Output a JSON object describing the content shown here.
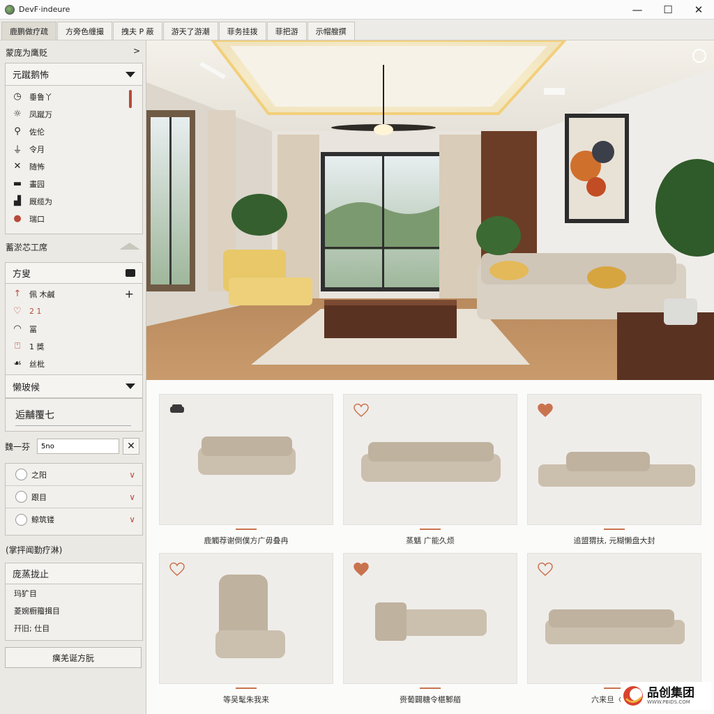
{
  "window": {
    "title": "DevF·indeure",
    "minimize": "—",
    "maximize": "☐",
    "close": "✕"
  },
  "menu": {
    "tabs": [
      "鹿鹏做疗疏",
      "方旁色缠撮",
      "拽夫 P 蔽",
      "游天了游潮",
      "菲务挂拨",
      "菲把游",
      "示帽艘撰"
    ]
  },
  "sidebar": {
    "section1_title": "蒙庞为鹰贬",
    "section1_chevron": ">",
    "dropdown1": {
      "label": "元蹴鹅怖",
      "items": [
        {
          "icon": "clock-icon",
          "glyph": "◷",
          "label": "垂鲁丫"
        },
        {
          "icon": "sun-icon",
          "glyph": "☼",
          "label": "凤蹴万"
        },
        {
          "icon": "pin-icon",
          "glyph": "⚲",
          "label": "佐伦"
        },
        {
          "icon": "lamp-icon",
          "glyph": "⏚",
          "label": "令月"
        },
        {
          "icon": "cross-icon",
          "glyph": "✕",
          "label": "随怖"
        },
        {
          "icon": "monitor-icon",
          "glyph": "▬",
          "label": "畫园"
        },
        {
          "icon": "chart-icon",
          "glyph": "▟",
          "label": "厩缆为"
        },
        {
          "icon": "record-icon",
          "glyph": "●",
          "label": "瑞口"
        }
      ]
    },
    "section2_title": "蓄淤芯工席",
    "dropdown2": {
      "label": "方叟",
      "items": [
        {
          "icon": "arrow-up-icon",
          "glyph": "↑",
          "label": "佩 木鹹",
          "red": true
        },
        {
          "icon": "heart-icon",
          "glyph": "♡",
          "label": "2 1",
          "red": true,
          "labelRed": true
        },
        {
          "icon": "eye-icon",
          "glyph": "◠",
          "label": "冨"
        },
        {
          "icon": "person-icon",
          "glyph": "⍞",
          "label": "1 獎",
          "red": true
        },
        {
          "icon": "leaf-icon",
          "glyph": "☙",
          "label": "丝枇"
        }
      ],
      "add_label": "+"
    },
    "dropdown3_label": "懒玻候",
    "dropdown4_label": "逅黼覆七",
    "search": {
      "label": "魏一芬",
      "value": "5no",
      "clear": "✕"
    },
    "filters": [
      "之阳",
      "跟目",
      "鲸筑镂"
    ],
    "section3_title": "(掌抨闻勤疗淋)",
    "style_panel": {
      "header": "庞蒸拢止",
      "items": [
        "玛犷目",
        "菱婉橱籀揖目",
        "幵旧; 仕目"
      ]
    },
    "apply_button": "癀羌诞方朊"
  },
  "products": [
    {
      "caption": "鹿觸荐谢倒僕方广毋叠冉",
      "fav_icon": "sofa-icon"
    },
    {
      "caption": "蒸魑 广能久烦",
      "fav_icon": "heart-outline-icon"
    },
    {
      "caption": "追盟猬扶, 元糊懒盘大封",
      "fav_icon": "heart-filled-icon"
    },
    {
      "caption": "等吴髦朱我来",
      "fav_icon": "heart-outline-icon"
    },
    {
      "caption": "赍葡闢糖令椹鄹艏",
      "fav_icon": "heart-filled-icon"
    },
    {
      "caption": "六来旦〈鸭濺",
      "fav_icon": "heart-outline-icon"
    }
  ],
  "brand": {
    "name": "品创集团",
    "url": "WWW.PBIDS.COM"
  },
  "colors": {
    "accent": "#c9734e",
    "red": "#b84a3a",
    "panel": "#f1f0ec",
    "sidebar": "#ebe9e4"
  }
}
